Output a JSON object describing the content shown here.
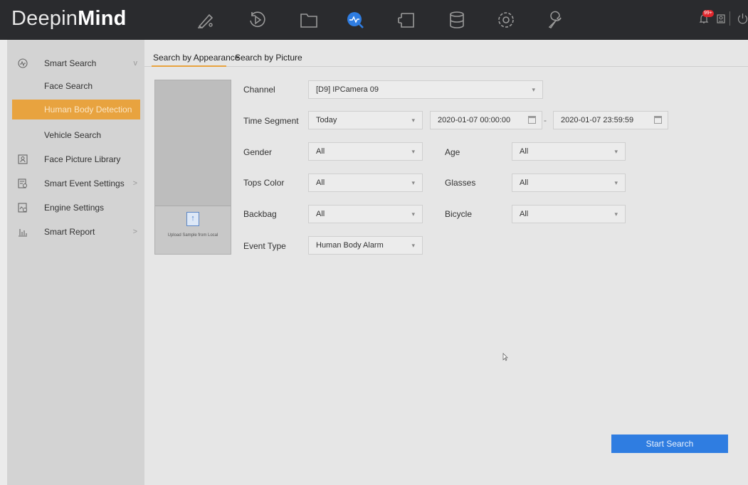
{
  "app": {
    "brand_light": "Deepin",
    "brand_bold": "Mind"
  },
  "header": {
    "nav_icons": [
      "live-view-icon",
      "playback-icon",
      "file-management-icon",
      "smart-analysis-icon",
      "camera-icon",
      "storage-icon",
      "system-config-icon",
      "maintenance-icon"
    ],
    "active_icon": "smart-analysis-icon",
    "alarm_badge": "99+",
    "accent_color": "#2f7de1"
  },
  "sidebar": {
    "items": [
      {
        "label": "Smart Search",
        "icon": "smart-search-icon",
        "chevron": "v"
      },
      {
        "label": "Face Search",
        "icon": ""
      },
      {
        "label": "Human Body Detection",
        "icon": "",
        "active": true
      },
      {
        "label": "Vehicle Search",
        "icon": ""
      },
      {
        "label": "Face Picture Library",
        "icon": "face-library-icon"
      },
      {
        "label": "Smart Event Settings",
        "icon": "event-settings-icon",
        "chevron": ">"
      },
      {
        "label": "Engine Settings",
        "icon": "engine-settings-icon"
      },
      {
        "label": "Smart Report",
        "icon": "report-icon",
        "chevron": ">"
      }
    ],
    "active_color": "#e8a33f"
  },
  "tabs": [
    {
      "label": "Search by Appearance",
      "active": true
    },
    {
      "label": "Search by Picture",
      "active": false
    }
  ],
  "upload": {
    "label": "Upload Sample from Local",
    "icon": "upload-icon"
  },
  "form": {
    "channel": {
      "label": "Channel",
      "value": "[D9] IPCamera 09"
    },
    "time_segment": {
      "label": "Time Segment",
      "value": "Today",
      "start": "2020-01-07 00:00:00",
      "end": "2020-01-07 23:59:59",
      "separator": "-"
    },
    "gender": {
      "label": "Gender",
      "value": "All"
    },
    "age": {
      "label": "Age",
      "value": "All"
    },
    "tops_color": {
      "label": "Tops Color",
      "value": "All"
    },
    "glasses": {
      "label": "Glasses",
      "value": "All"
    },
    "backbag": {
      "label": "Backbag",
      "value": "All"
    },
    "bicycle": {
      "label": "Bicycle",
      "value": "All"
    },
    "event_type": {
      "label": "Event Type",
      "value": "Human Body Alarm"
    }
  },
  "actions": {
    "start_search": "Start Search"
  }
}
